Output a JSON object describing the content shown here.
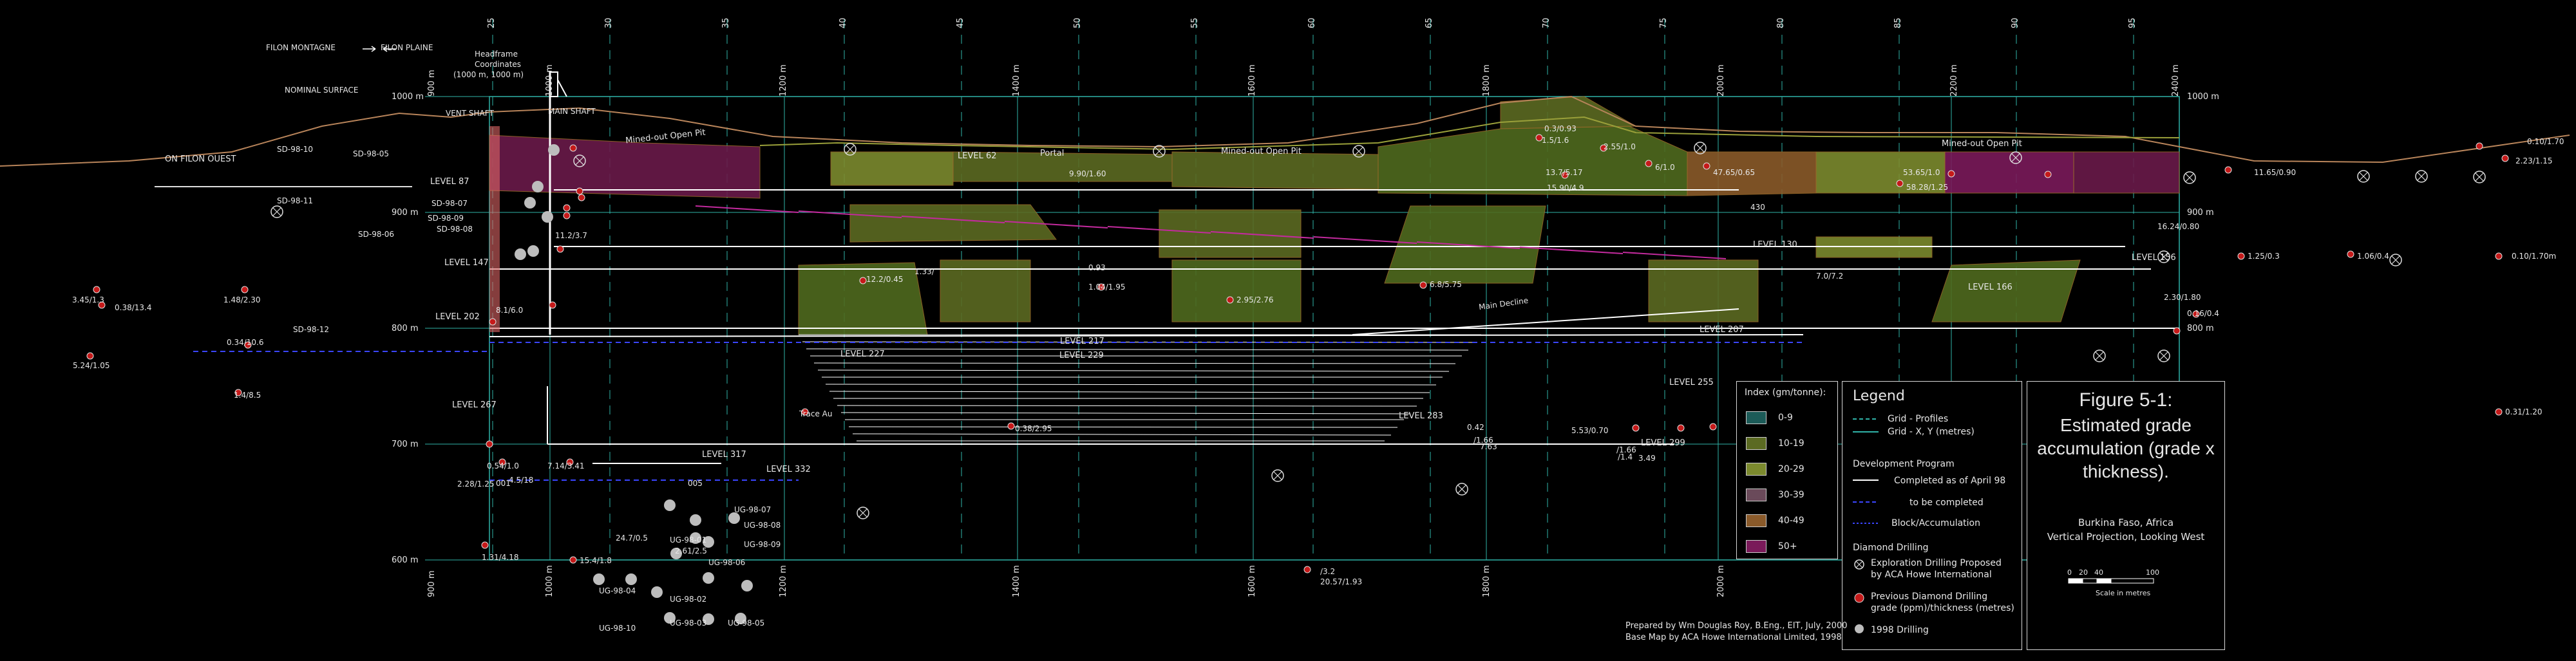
{
  "colors": {
    "grid": "#2fb3a8",
    "pit": "#9a6a2a",
    "surface": "#b8845a",
    "workings": "#ffffff",
    "drillhole": "#c51a1a",
    "accent_magenta": "#c22a9d"
  },
  "top_labels": {
    "filon_montagne": "FILON MONTAGNE",
    "filon_plaine": "FILON PLAINE",
    "nominal_surface": "NOMINAL SURFACE",
    "headframe": [
      "Headframe",
      "Coordinates",
      "(1000 m, 1000 m)"
    ],
    "vent_shaft": "VENT SHAFT",
    "main_shaft": "MAIN SHAFT",
    "on_filon_ouest": "ON FILON OUEST",
    "pit_left": "Mined-out Open Pit",
    "portal": "Portal",
    "pit_mid": "Mined-out Open Pit",
    "pit_right": "Mined-out Open Pit"
  },
  "section_numbers": [
    "25",
    "30",
    "35",
    "40",
    "45",
    "50",
    "55",
    "60",
    "65",
    "70",
    "75",
    "80",
    "85",
    "90",
    "95"
  ],
  "easting_labels": [
    "900 m",
    "1000 m",
    "1200 m",
    "1400 m",
    "1600 m",
    "1800 m",
    "2000 m",
    "2200 m",
    "2400 m"
  ],
  "elevation_labels": [
    "1000 m",
    "900 m",
    "800 m",
    "700 m",
    "600 m"
  ],
  "levels": [
    "LEVEL 62",
    "LEVEL 87",
    "LEVEL 130",
    "LEVEL 147",
    "LEVEL 156",
    "LEVEL 166",
    "LEVEL 202",
    "LEVEL 207",
    "LEVEL 217",
    "LEVEL 227",
    "LEVEL 229",
    "LEVEL 255",
    "LEVEL 267",
    "LEVEL 283",
    "LEVEL 299",
    "LEVEL 317",
    "LEVEL 332"
  ],
  "drillholes": [
    "SD-98-10",
    "SD-98-05",
    "SD-98-11",
    "SD-98-07",
    "SD-98-09",
    "SD-98-06",
    "SD-98-08",
    "SD-98-12",
    "UG-98-07",
    "UG-98-08",
    "UG-98-09",
    "UG-98-01",
    "UG-98-04",
    "UG-98-02",
    "UG-98-06",
    "UG-98-10",
    "UG-98-03",
    "UG-98-05"
  ],
  "grade_labels": [
    "0.3/0.93",
    "1.5/1.6",
    "13.7/5.17",
    "2.55/1.0",
    "6/1.0",
    "47.65/0.65",
    "53.65/1.0",
    "11.65/0.90",
    "0.10/1.70",
    "2.23/1.15",
    "9.90/1.60",
    "15.90/4.9",
    "58.28/1.25",
    "16.24/0.80",
    "11.2/3.7",
    "12.2/0.45",
    "1.33/",
    "1.04/1.95",
    "0.93",
    "2.95/2.76",
    "6.8/5.75",
    "7.0/7.2",
    "2.30/1.80",
    "1.25/0.3",
    "1.06/0.4",
    "0.10/1.70m",
    "0.16/0.4",
    "3.45/1.3",
    "0.38/13.4",
    "1.48/2.30",
    "0.34/10.6",
    "5.24/1.05",
    "1.4/8.5",
    "8.1/6.0",
    "0.31/1.20",
    "0.38/2.95",
    "0.42",
    "/1.66",
    "5.53/0.70",
    "7.63",
    "/1.66",
    "/1.4",
    "3.49",
    "2.69",
    "/3.2",
    "20.57/1.93",
    "24.7/0.5",
    "2.61/2.5",
    "15.4/1.8",
    "1.31/4.18",
    "0.54/1.0",
    "7.14/3.41",
    "4.5/18",
    "2.28/1.25"
  ],
  "misc_labels": {
    "trace_au": "Trace Au",
    "main_decline": "Main Decline",
    "l430": "430",
    "cap_005": "005",
    "cap_001": "001"
  },
  "index": {
    "title": "Index (gm/tonne):",
    "items": [
      {
        "label": "0-9",
        "color": "#1c5b58"
      },
      {
        "label": "10-19",
        "color": "#5b6a22"
      },
      {
        "label": "20-29",
        "color": "#7c8a2e"
      },
      {
        "label": "30-39",
        "color": "#6a4a5a"
      },
      {
        "label": "40-49",
        "color": "#8a5a2a"
      },
      {
        "label": "50+",
        "color": "#7a1a5a"
      }
    ]
  },
  "legend": {
    "title": "Legend",
    "grid_profiles": "Grid - Profiles",
    "grid_xy": "Grid - X, Y (metres)",
    "dev_program": "Development Program",
    "completed": "Completed as of April 98",
    "to_complete": "to be completed",
    "block": "Block/Accumulation",
    "diamond": "Diamond Drilling",
    "exploration": [
      "Exploration Drilling Proposed",
      "by ACA Howe International"
    ],
    "previous": [
      "Previous Diamond Drilling",
      "grade (ppm)/thickness (metres)"
    ],
    "drilling_1998": "1998 Drilling"
  },
  "figure": {
    "title": "Figure 5-1:",
    "subtitle": [
      "Estimated grade",
      "accumulation (grade x",
      "thickness)."
    ],
    "location": "Burkina Faso, Africa",
    "projection": "Vertical Projection, Looking West",
    "scale_ticks": [
      "0",
      "20",
      "40",
      "100"
    ],
    "scale_label": "Scale in metres"
  },
  "credits": [
    "Prepared by Wm Douglas Roy, B.Eng., EIT, July, 2000",
    "Base Map by ACA Howe International Limited, 1998"
  ]
}
